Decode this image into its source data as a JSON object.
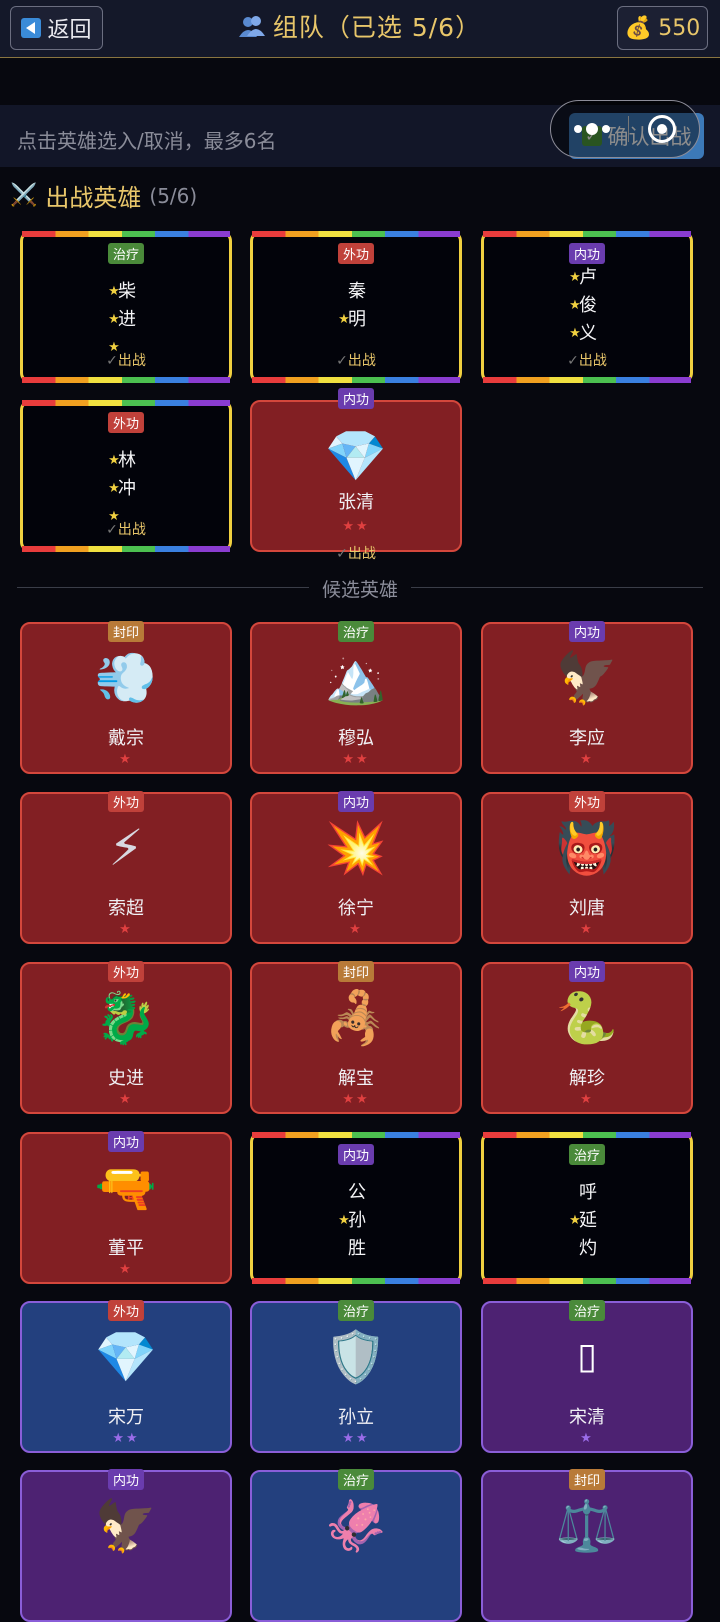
{
  "header": {
    "back_label": "返回",
    "title": "组队（已选 5/6）",
    "coins": "550"
  },
  "hint": "点击英雄选入/取消，最多6名",
  "confirm_label": "确认出战",
  "selected_section": {
    "title": "出战英雄",
    "count": "(5/6)"
  },
  "candidate_title": "候选英雄",
  "battle_label": "出战",
  "colors": {
    "gold": "#e8c66a",
    "red_card": "#821f23",
    "blue_card": "#23407e",
    "purple_card": "#4d2272"
  },
  "selected": [
    {
      "name": "柴进",
      "tag": "治疗",
      "stars": 3,
      "style": "legend"
    },
    {
      "name": "秦明",
      "tag": "外功",
      "stars": 1,
      "style": "legend"
    },
    {
      "name": "卢俊义",
      "tag": "内功",
      "stars": 3,
      "style": "legend"
    },
    {
      "name": "林冲",
      "tag": "外功",
      "stars": 3,
      "style": "legend"
    },
    {
      "name": "张清",
      "tag": "内功",
      "stars": "★★",
      "style": "red",
      "icon": "diamond-icon"
    }
  ],
  "candidates": [
    {
      "name": "戴宗",
      "tag": "封印",
      "stars": "★",
      "style": "red",
      "icon": "wind-icon"
    },
    {
      "name": "穆弘",
      "tag": "治疗",
      "stars": "★★",
      "style": "red",
      "icon": "mountain-icon"
    },
    {
      "name": "李应",
      "tag": "内功",
      "stars": "★",
      "style": "red",
      "icon": "eagle-icon"
    },
    {
      "name": "索超",
      "tag": "外功",
      "stars": "★",
      "style": "red",
      "icon": "lightning-icon"
    },
    {
      "name": "徐宁",
      "tag": "内功",
      "stars": "★",
      "style": "red",
      "icon": "burst-icon"
    },
    {
      "name": "刘唐",
      "tag": "外功",
      "stars": "★",
      "style": "red",
      "icon": "ogre-icon"
    },
    {
      "name": "史进",
      "tag": "外功",
      "stars": "★",
      "style": "red",
      "icon": "dragon-icon"
    },
    {
      "name": "解宝",
      "tag": "封印",
      "stars": "★★",
      "style": "red",
      "icon": "scorpion-icon"
    },
    {
      "name": "解珍",
      "tag": "内功",
      "stars": "★",
      "style": "red",
      "icon": "snake-icon"
    },
    {
      "name": "董平",
      "tag": "内功",
      "stars": "★",
      "style": "red",
      "icon": "water-pistol-icon"
    },
    {
      "name": "公孙胜",
      "tag": "内功",
      "stars": 1,
      "style": "legend"
    },
    {
      "name": "呼延灼",
      "tag": "治疗",
      "stars": 1,
      "style": "legend"
    },
    {
      "name": "宋万",
      "tag": "外功",
      "stars": "★★",
      "style": "blue",
      "icon": "diamond-icon"
    },
    {
      "name": "孙立",
      "tag": "治疗",
      "stars": "★★",
      "style": "blue",
      "icon": "shield-icon"
    },
    {
      "name": "宋清",
      "tag": "治疗",
      "stars": "★",
      "style": "purple",
      "icon": "unknown-glyph-icon"
    },
    {
      "name": "",
      "tag": "内功",
      "stars": "",
      "style": "purple",
      "icon": "eagle-icon"
    },
    {
      "name": "",
      "tag": "治疗",
      "stars": "",
      "style": "blue",
      "icon": "squid-icon"
    },
    {
      "name": "",
      "tag": "封印",
      "stars": "",
      "style": "purple",
      "icon": "scales-icon"
    }
  ]
}
